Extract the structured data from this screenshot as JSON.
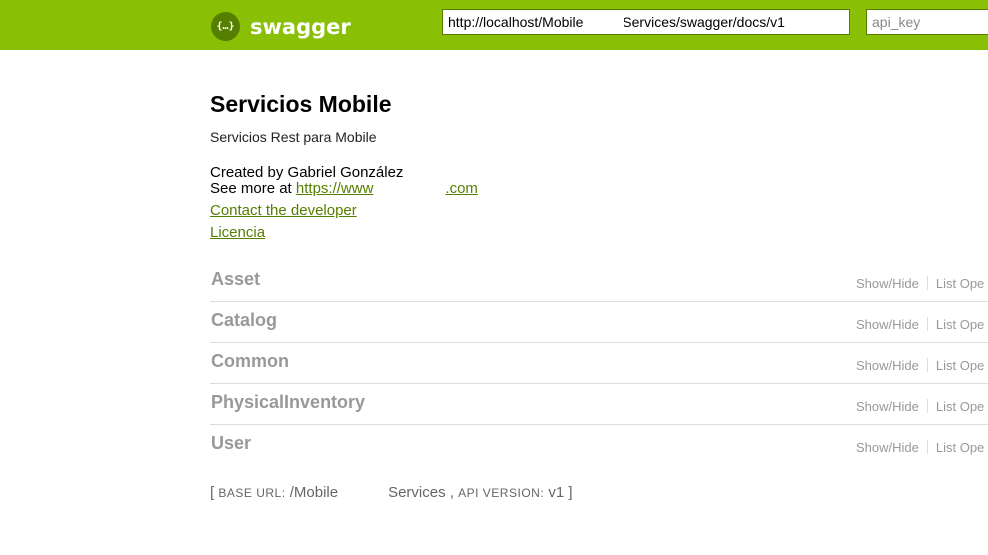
{
  "header": {
    "logo_icon": "{…}",
    "logo_text": "swagger",
    "url_value": "http://localhost/Mobile          Services/swagger/docs/v1",
    "api_key_placeholder": "api_key",
    "bg_color": "#89bf04"
  },
  "info": {
    "title": "Servicios Mobile",
    "description": "Servicios Rest para Mobile",
    "created_by": "Created by Gabriel González",
    "see_more_prefix": "See more at ",
    "see_more_link_start": "https://www",
    "see_more_link_end": ".com",
    "contact_label": "Contact the developer",
    "license_label": "Licencia",
    "link_color": "#547f00"
  },
  "resources": [
    {
      "name": "Asset",
      "show_hide": "Show/Hide",
      "list_ops": "List Ope"
    },
    {
      "name": "Catalog",
      "show_hide": "Show/Hide",
      "list_ops": "List Ope"
    },
    {
      "name": "Common",
      "show_hide": "Show/Hide",
      "list_ops": "List Ope"
    },
    {
      "name": "PhysicalInventory",
      "show_hide": "Show/Hide",
      "list_ops": "List Ope"
    },
    {
      "name": "User",
      "show_hide": "Show/Hide",
      "list_ops": "List Ope"
    }
  ],
  "footer": {
    "open_bracket": "[",
    "base_url_label": "BASE URL:",
    "base_url_start": "/Mobile",
    "base_url_end": "Services",
    "separator": ",",
    "api_version_label": "API VERSION:",
    "api_version": "v1",
    "close_bracket": "]"
  }
}
